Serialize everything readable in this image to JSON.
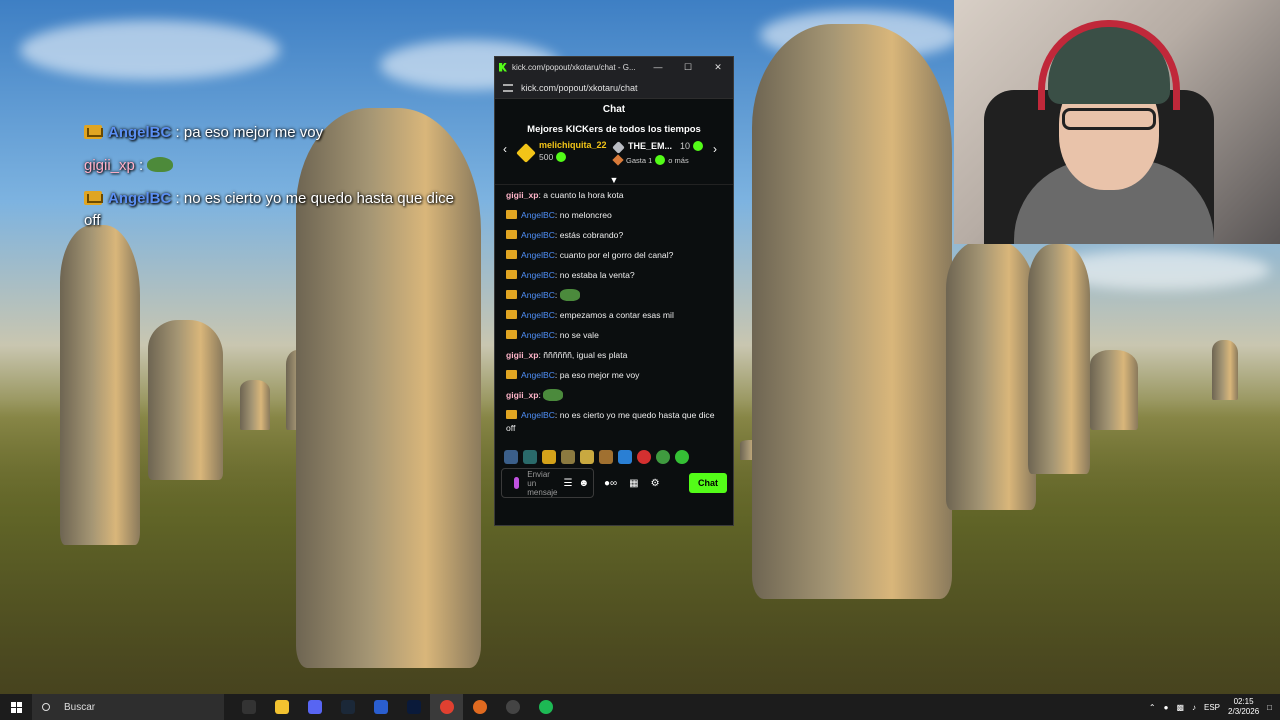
{
  "overlay_chat": [
    {
      "user": "AngelBC",
      "text": " : pa eso mejor me voy",
      "badge": true
    },
    {
      "user": "gigii_xp",
      "text": " : ",
      "emote": "frog-emote",
      "badge": false
    },
    {
      "user": "AngelBC",
      "text": " : no es cierto yo me quedo hasta que dice off",
      "badge": true
    }
  ],
  "window": {
    "title": "kick.com/popout/xkotaru/chat - G...",
    "address": "kick.com/popout/xkotaru/chat",
    "controls": {
      "minimize": "—",
      "maximize": "☐",
      "close": "✕"
    }
  },
  "chat": {
    "header": "Chat",
    "leaderboard_title": "Mejores KICKers de todos los tiempos",
    "leaders": [
      {
        "name": "melichiquita_22",
        "value": "500"
      },
      {
        "name": "THE_EM...",
        "value": "10",
        "sub": "Gasta 1",
        "sub2": "o más"
      }
    ],
    "messages": [
      {
        "user": "gigii_xp",
        "text": ": a cuanto la hora kota",
        "badge": false,
        "color": "pink"
      },
      {
        "user": "AngelBC",
        "text": ": no meloncreo",
        "badge": true,
        "color": "blue"
      },
      {
        "user": "AngelBC",
        "text": ": estás cobrando?",
        "badge": true,
        "color": "blue"
      },
      {
        "user": "AngelBC",
        "text": ": cuanto por el gorro del canal?",
        "badge": true,
        "color": "blue"
      },
      {
        "user": "AngelBC",
        "text": ": no estaba la venta?",
        "badge": true,
        "color": "blue"
      },
      {
        "user": "AngelBC",
        "text": ": ",
        "badge": true,
        "color": "blue",
        "emote": true
      },
      {
        "user": "AngelBC",
        "text": ": empezamos a contar esas mil",
        "badge": true,
        "color": "blue"
      },
      {
        "user": "AngelBC",
        "text": ": no se vale",
        "badge": true,
        "color": "blue"
      },
      {
        "user": "gigii_xp",
        "text": ": ññññññ, igual es plata",
        "badge": false,
        "color": "pink"
      },
      {
        "user": "AngelBC",
        "text": ": pa eso mejor me voy",
        "badge": true,
        "color": "blue"
      },
      {
        "user": "gigii_xp",
        "text": ": ",
        "badge": false,
        "color": "pink",
        "emote": true
      },
      {
        "user": "AngelBC",
        "text": ": no es cierto yo me quedo hasta que dice off",
        "badge": true,
        "color": "blue"
      }
    ],
    "input_placeholder": "Enviar un mensaje",
    "send_label": "Chat",
    "emote_colors": [
      "#3b5f8a",
      "#2a6a6a",
      "#d4a21a",
      "#8c7a40",
      "#c9a940",
      "#a07030",
      "#2a7fd4",
      "#d43030",
      "#3f9a3f",
      "#35c035"
    ]
  },
  "taskbar": {
    "search_placeholder": "Buscar",
    "language": "ESP",
    "time": "02:15",
    "date": "2/3/2026",
    "apps": [
      {
        "name": "epic-games-icon",
        "color": "#333333"
      },
      {
        "name": "file-explorer-icon",
        "color": "#f2c230"
      },
      {
        "name": "discord-icon",
        "color": "#5865f2"
      },
      {
        "name": "steam-icon",
        "color": "#1b2838"
      },
      {
        "name": "vs-icon",
        "color": "#2a5ecf"
      },
      {
        "name": "photoshop-icon",
        "color": "#0a1a3a"
      },
      {
        "name": "chrome-icon",
        "color": "#e04030"
      },
      {
        "name": "browser-icon",
        "color": "#e06a20"
      },
      {
        "name": "obs-icon",
        "color": "#444444"
      },
      {
        "name": "spotify-icon",
        "color": "#1db954"
      }
    ]
  }
}
